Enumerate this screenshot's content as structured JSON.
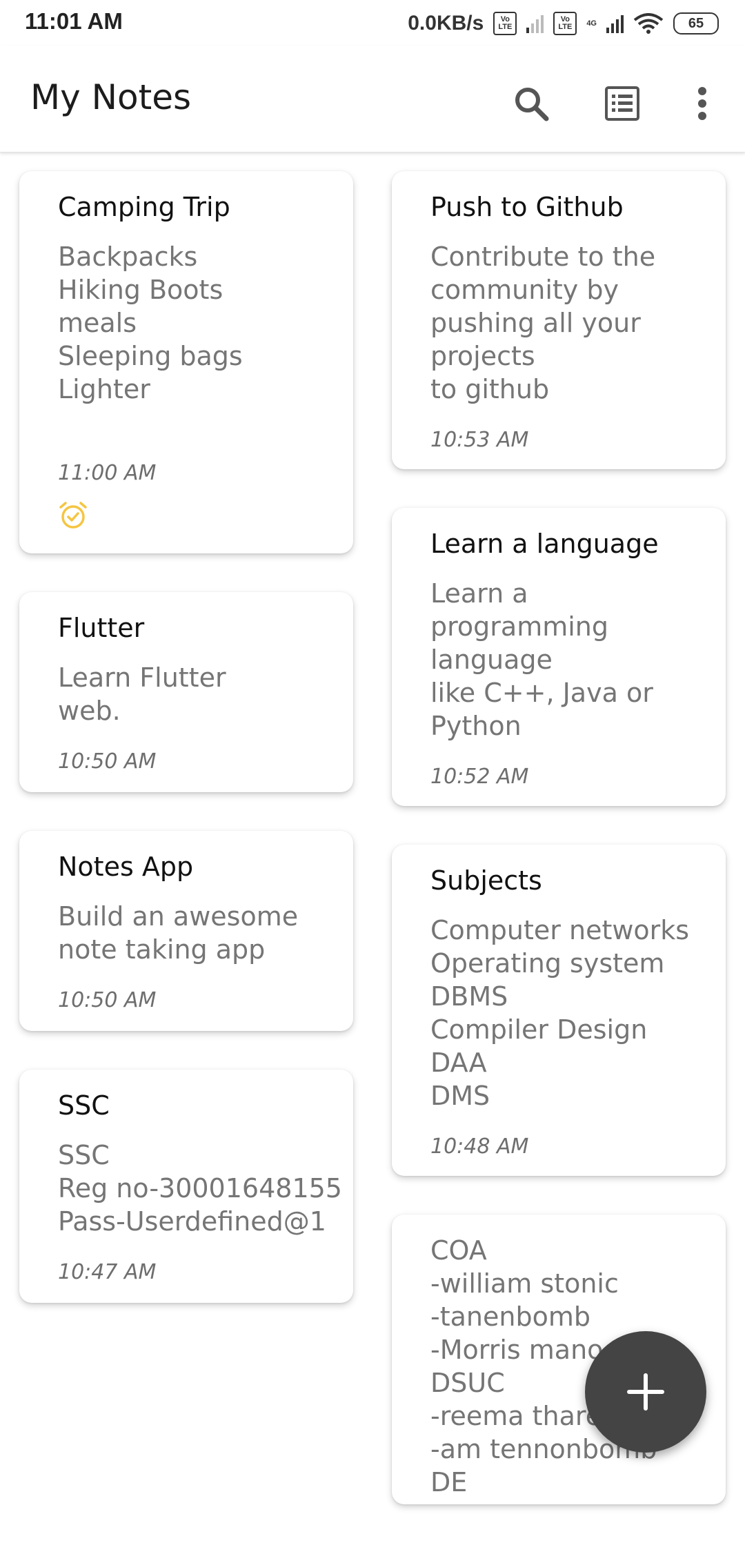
{
  "status_bar": {
    "time": "11:01 AM",
    "network_speed": "0.0KB/s",
    "sim1_badge": "Vo LTE",
    "sim2_badge": "Vo LTE",
    "sim2_tech": "4G",
    "battery": "65"
  },
  "app_bar": {
    "title": "My Notes",
    "icons": [
      "search-icon",
      "list-view-icon",
      "more-vert-icon"
    ]
  },
  "notes_left": [
    {
      "title": "Camping Trip",
      "body": "Backpacks\nHiking Boots\nmeals\nSleeping bags\nLighter",
      "time": "11:00 AM",
      "reminder": true
    },
    {
      "title": "Flutter",
      "body": "Learn Flutter\nweb.",
      "time": "10:50 AM"
    },
    {
      "title": "Notes App",
      "body": "Build an awesome\nnote taking app",
      "time": "10:50 AM"
    },
    {
      "title": "SSC",
      "body": "SSC\nReg no-30001648155\nPass-Userdefined@1",
      "time": "10:47 AM"
    }
  ],
  "notes_right": [
    {
      "title": "Push to Github",
      "body": "Contribute to the\ncommunity by\npushing all your\nprojects\nto github",
      "time": "10:53 AM"
    },
    {
      "title": "Learn a language",
      "body": "Learn a\nprogramming\nlanguage\nlike C++, Java or\nPython",
      "time": "10:52 AM"
    },
    {
      "title": "Subjects",
      "body": "Computer networks\nOperating system\nDBMS\nCompiler Design\nDAA\nDMS",
      "time": "10:48 AM"
    },
    {
      "title": "",
      "body": "COA\n-william stonic\n-tanenbomb\n-Morris mano\nDSUC\n-reema thareja\n-am tennonbomb\nDE"
    }
  ],
  "colors": {
    "reminder": "#F5C542",
    "fab": "#444444",
    "body_text": "#757575"
  },
  "fab_icon": "plus-icon"
}
